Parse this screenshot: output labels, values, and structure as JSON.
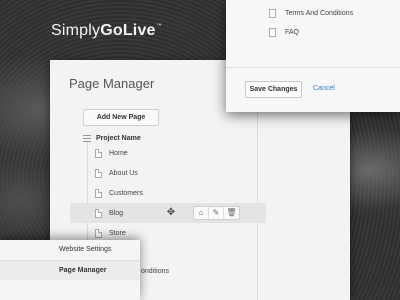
{
  "brand": {
    "name_light": "Simply",
    "name_bold": "GoLive",
    "trademark": "™"
  },
  "page_manager": {
    "title": "Page Manager",
    "add_button": "Add New Page",
    "project_name": "Project Name",
    "pages": [
      {
        "label": "Home"
      },
      {
        "label": "About Us"
      },
      {
        "label": "Customers"
      },
      {
        "label": "Blog"
      },
      {
        "label": "Store"
      }
    ],
    "active_page": "Blog",
    "row_actions": {
      "home_icon": "home-icon",
      "edit_icon": "wrench-icon",
      "delete_icon": "trash-icon"
    },
    "move_icon": "move-arrows-icon",
    "partial_row_text": "onditions"
  },
  "dialog": {
    "items": [
      {
        "label": "Terms And Conditions"
      },
      {
        "label": "FAQ"
      }
    ],
    "save_label": "Save Changes",
    "cancel_label": "Cancel"
  },
  "side_menu": {
    "items": [
      {
        "label": "Website Settings"
      },
      {
        "label": "Page Manager"
      }
    ],
    "selected": "Page Manager"
  },
  "colors": {
    "link": "#3d7bbf",
    "panel": "#f3f3f3",
    "background": "#2e2e2e"
  }
}
